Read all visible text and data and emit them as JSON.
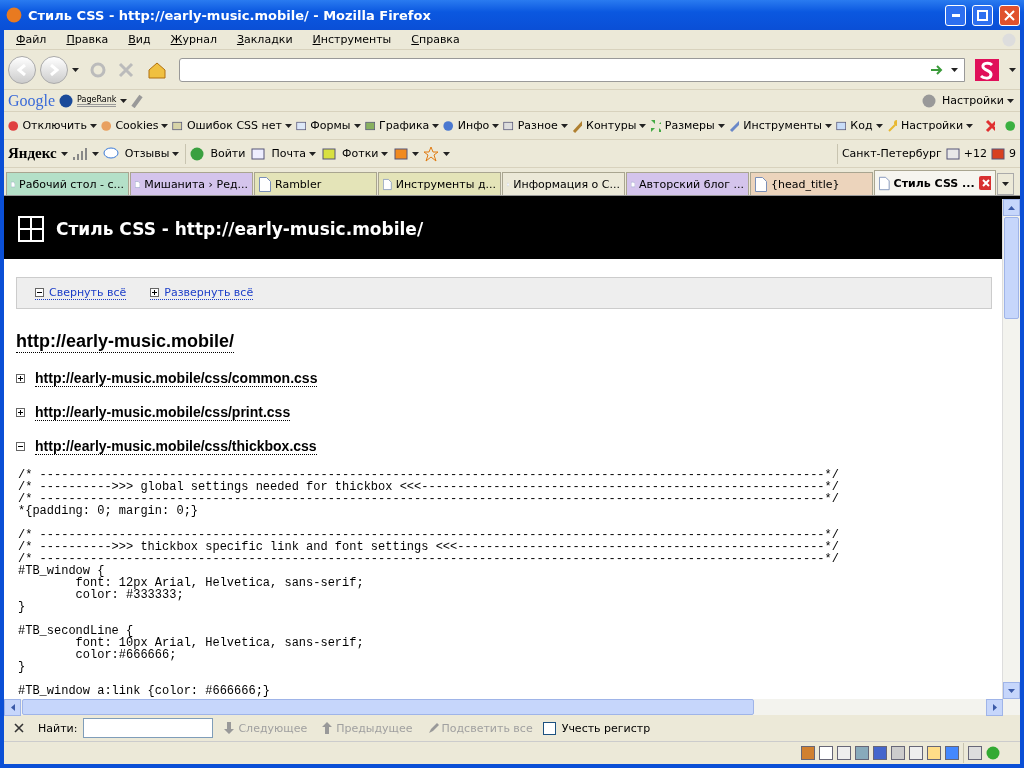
{
  "window": {
    "title": "Стиль CSS - http://early-music.mobile/ - Mozilla Firefox"
  },
  "menu": [
    "Файл",
    "Правка",
    "Вид",
    "Журнал",
    "Закладки",
    "Инструменты",
    "Справка"
  ],
  "google_bar": {
    "logo": "Google",
    "pagerank": "PageRank",
    "settings": "Настройки"
  },
  "webdev_bar": [
    "Отключить",
    "Cookies",
    "Ошибок CSS нет",
    "Формы",
    "Графика",
    "Инфо",
    "Разное",
    "Контуры",
    "Размеры",
    "Инструменты",
    "Код",
    "Настройки"
  ],
  "yandex_bar": {
    "logo": "Яндекс",
    "items": [
      "Отзывы",
      "Войти",
      "Почта",
      "Фотки"
    ],
    "city": "Санкт-Петербург",
    "temperature": "+12",
    "count": "9"
  },
  "tabs": [
    {
      "label": "Рабочий стол - с...",
      "selected": false,
      "color": "#b4e0c8"
    },
    {
      "label": "Мишанита › Ред...",
      "selected": false,
      "color": "#d4c4ec"
    },
    {
      "label": "Rambler",
      "selected": false,
      "color": "#e4e4b8"
    },
    {
      "label": "Инструменты д...",
      "selected": false,
      "color": "#e4e4b8"
    },
    {
      "label": "Информация о С...",
      "selected": false,
      "color": "#ece9d8"
    },
    {
      "label": "Авторский блог ...",
      "selected": false,
      "color": "#d4c4ec"
    },
    {
      "label": "{head_title}",
      "selected": false,
      "color": "#ecd4bc"
    },
    {
      "label": "Стиль CSS ...",
      "selected": true,
      "color": "#f6f5ef"
    }
  ],
  "page": {
    "header": "Стиль CSS - http://early-music.mobile/",
    "controls": [
      {
        "label": "Свернуть всё",
        "kind": "collapse"
      },
      {
        "label": "Развернуть всё",
        "kind": "expand"
      }
    ],
    "site": "http://early-music.mobile/",
    "files": [
      {
        "url": "http://early-music.mobile/css/common.css",
        "expanded": false
      },
      {
        "url": "http://early-music.mobile/css/print.css",
        "expanded": false
      },
      {
        "url": "http://early-music.mobile/css/thickbox.css",
        "expanded": true
      }
    ],
    "code": [
      [
        "/* -------------------------------------------------------------------------------------------------------------*/",
        "/* ---------->>> global settings needed for thickbox <<<--------------------------------------------------------*/",
        "/* -------------------------------------------------------------------------------------------------------------*/",
        "*{padding: 0; margin: 0;}"
      ],
      [
        "/* -------------------------------------------------------------------------------------------------------------*/",
        "/* ---------->>> thickbox specific link and font settings <<<---------------------------------------------------*/",
        "/* -------------------------------------------------------------------------------------------------------------*/",
        "#TB_window {",
        "\tfont: 12px Arial, Helvetica, sans-serif;",
        "\tcolor: #333333;",
        "}"
      ],
      [
        "#TB_secondLine {",
        "\tfont: 10px Arial, Helvetica, sans-serif;",
        "\tcolor:#666666;",
        "}"
      ],
      [
        "#TB_window a:link {color: #666666;}"
      ]
    ]
  },
  "find_bar": {
    "label": "Найти:",
    "buttons": [
      {
        "label": "Следующее",
        "disabled": true
      },
      {
        "label": "Предыдущее",
        "disabled": true
      },
      {
        "label": "Подсветить все",
        "disabled": true
      }
    ],
    "match_case": {
      "label": "Учесть регистр",
      "checked": false
    }
  }
}
